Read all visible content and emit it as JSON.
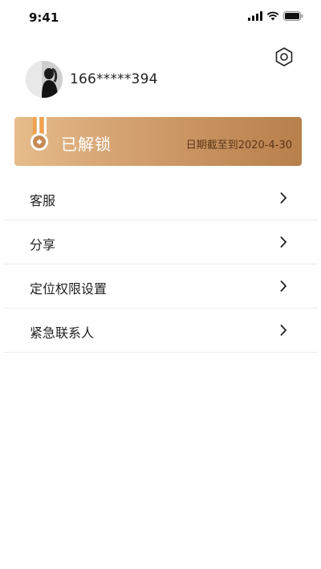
{
  "status_bar": {
    "time": "9:41",
    "icons": [
      "cellular-signal-icon",
      "wifi-icon",
      "battery-icon"
    ]
  },
  "header": {
    "settings_icon": "hexagon-settings-icon",
    "phone": "166*****394"
  },
  "vip": {
    "title": "已解锁",
    "expiry": "日期截至到2020-4-30",
    "colors": {
      "gradient_start": "#e6bc8b",
      "gradient_end": "#b77f4b",
      "expiry_text": "#5b3416"
    }
  },
  "menu": {
    "items": [
      {
        "label": "客服"
      },
      {
        "label": "分享"
      },
      {
        "label": "定位权限设置"
      },
      {
        "label": "紧急联系人"
      }
    ]
  }
}
